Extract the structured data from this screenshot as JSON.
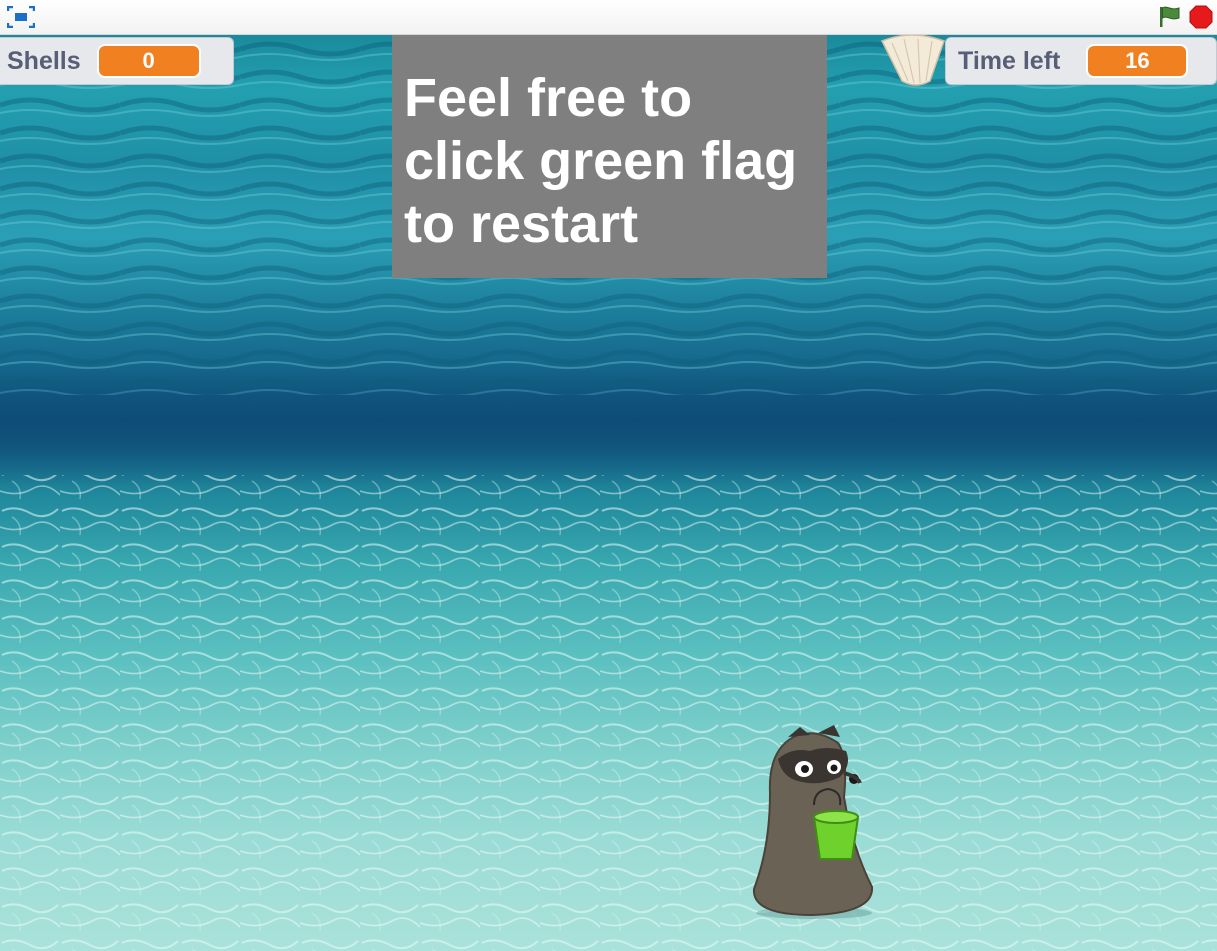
{
  "toolbar": {
    "fullscreen_icon": "fullscreen-icon",
    "green_flag_icon": "green-flag-icon",
    "stop_icon": "stop-sign-icon",
    "flag_color": "#4a8a3a",
    "stop_color": "#e61a1a"
  },
  "monitors": {
    "shells": {
      "label": "Shells",
      "value": "0"
    },
    "time_left": {
      "label": "Time left",
      "value": "16"
    },
    "value_color": "#f08020"
  },
  "message": {
    "text": "Feel free to\nclick green flag\nto restart",
    "background": "#7f7f7f"
  },
  "sprites": {
    "shell": "seashell-icon",
    "player": "otter-with-bucket"
  },
  "backdrop": "underwater-sandy-floor"
}
